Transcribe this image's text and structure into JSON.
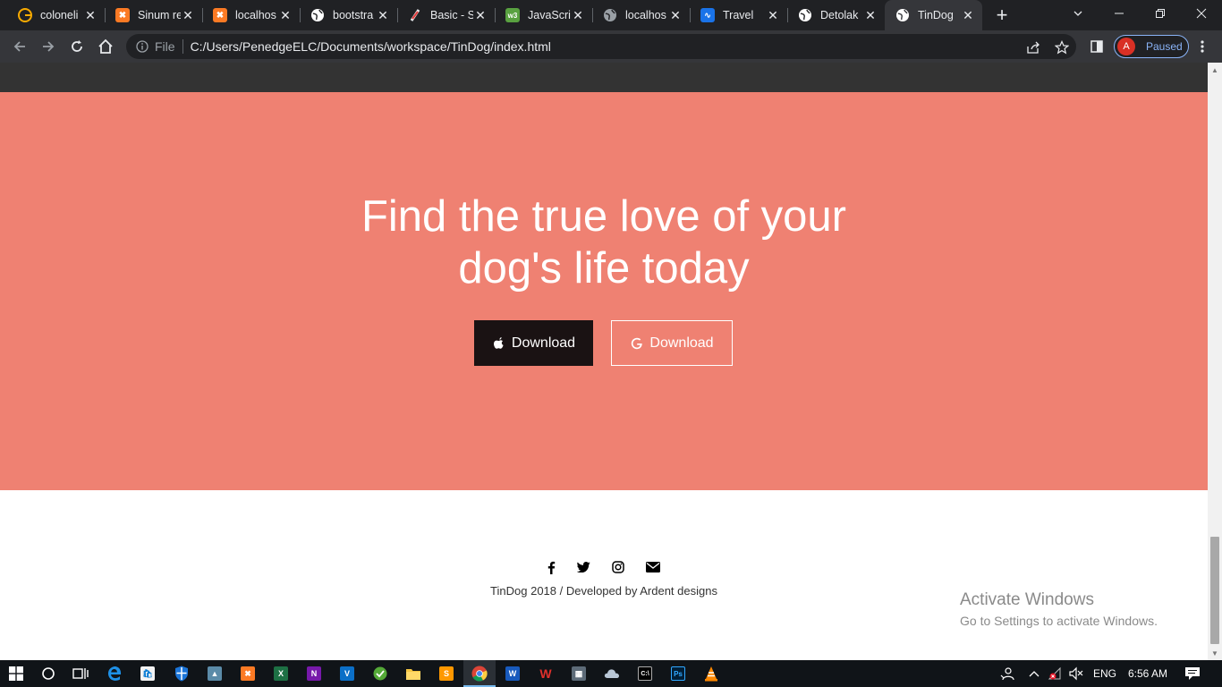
{
  "browser": {
    "tabs": [
      {
        "title": "coloneli",
        "favicon": "google-color-icon",
        "color": "#f9ab00"
      },
      {
        "title": "Sinum re",
        "favicon": "xampp-icon",
        "color": "#fb7a24"
      },
      {
        "title": "localhos",
        "favicon": "xampp-icon",
        "color": "#fb7a24"
      },
      {
        "title": "bootstra",
        "favicon": "globe-icon",
        "color": "#ffffff"
      },
      {
        "title": "Basic - S",
        "favicon": "feather-icon",
        "color": "#e8eaed"
      },
      {
        "title": "JavaScrip",
        "favicon": "w3schools-icon",
        "color": "#59a140"
      },
      {
        "title": "localhos",
        "favicon": "globe-icon",
        "color": "#9aa0a6"
      },
      {
        "title": "Travel",
        "favicon": "travel-icon",
        "color": "#1a73e8"
      },
      {
        "title": "Detolak",
        "favicon": "globe-icon",
        "color": "#ffffff"
      },
      {
        "title": "TinDog",
        "favicon": "globe-icon",
        "color": "#ffffff",
        "active": true
      }
    ],
    "address": {
      "scheme_label": "File",
      "url": "C:/Users/PenedgeELC/Documents/workspace/TinDog/index.html"
    },
    "profile": {
      "initial": "A",
      "status": "Paused"
    }
  },
  "page": {
    "hero": {
      "title_line1": "Find the true love of your",
      "title_line2": "dog's life today",
      "buttons": [
        {
          "label": "Download",
          "icon": "apple-icon",
          "style": "dark"
        },
        {
          "label": "Download",
          "icon": "google-icon",
          "style": "outline"
        }
      ],
      "background_color": "#ef8172"
    },
    "footer": {
      "social_icons": [
        "facebook-icon",
        "twitter-icon",
        "instagram-icon",
        "envelope-icon"
      ],
      "copyright": "TinDog 2018 / Developed by Ardent designs"
    },
    "watermark": {
      "line1": "Activate Windows",
      "line2": "Go to Settings to activate Windows."
    }
  },
  "taskbar": {
    "apps": [
      "start-icon",
      "search-icon",
      "task-view-icon",
      "edge-icon",
      "store-icon",
      "defender-icon",
      "photos-icon",
      "xampp-icon",
      "excel-icon",
      "onenote-icon",
      "vscode-icon",
      "greenshot-icon",
      "file-explorer-icon",
      "sublime-icon",
      "chrome-icon",
      "word-icon",
      "wps-icon",
      "calculator-icon",
      "cloud-icon",
      "cmd-icon",
      "photoshop-icon",
      "vlc-icon"
    ],
    "language": "ENG",
    "time": "6:56 AM"
  }
}
